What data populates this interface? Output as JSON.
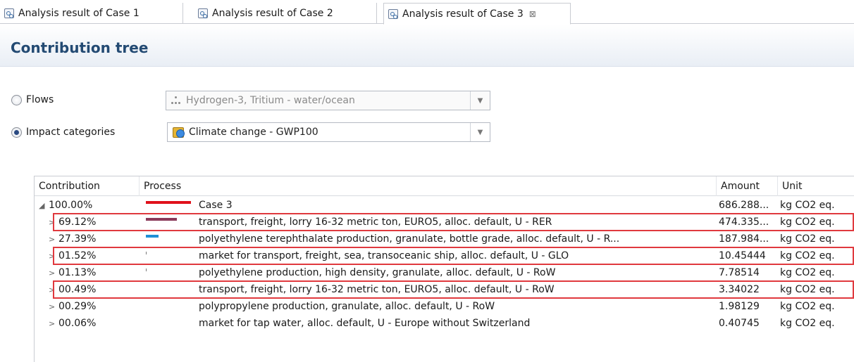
{
  "tabs": [
    {
      "label": "Analysis result of Case 1",
      "active": false
    },
    {
      "label": "Analysis result of Case 2",
      "active": false
    },
    {
      "label": "Analysis result of Case 3",
      "active": true,
      "close": "⊠"
    }
  ],
  "header": {
    "title": "Contribution tree"
  },
  "form": {
    "flows": {
      "label": "Flows",
      "selected": false,
      "value": "Hydrogen-3, Tritium - water/ocean",
      "disabled": true
    },
    "impact": {
      "label": "Impact categories",
      "selected": true,
      "value": "Climate change - GWP100"
    }
  },
  "table": {
    "headers": {
      "contribution": "Contribution",
      "process": "Process",
      "amount": "Amount",
      "unit": "Unit"
    },
    "rows": [
      {
        "toggle": "◢",
        "contribution": "100.00%",
        "process": "Case 3",
        "amount": "686.288...",
        "unit": "kg CO2 eq.",
        "share": 1.0,
        "color": "#e0111b",
        "highlight": false
      },
      {
        "toggle": ">",
        "contribution": "69.12%",
        "process": "transport, freight, lorry 16-32 metric ton, EURO5, alloc. default, U - RER",
        "amount": "474.335...",
        "unit": "kg CO2 eq.",
        "share": 0.6912,
        "color": "#8b3a5a",
        "highlight": true
      },
      {
        "toggle": ">",
        "contribution": "27.39%",
        "process": "polyethylene terephthalate production, granulate, bottle grade, alloc. default, U - R...",
        "amount": "187.984...",
        "unit": "kg CO2 eq.",
        "share": 0.2739,
        "color": "#1f8fd6",
        "highlight": false
      },
      {
        "toggle": ">",
        "contribution": "01.52%",
        "process": "market for transport, freight, sea, transoceanic ship, alloc. default, U - GLO",
        "amount": "10.45444",
        "unit": "kg CO2 eq.",
        "share": 0.0152,
        "color": "#7a7a7a",
        "highlight": true
      },
      {
        "toggle": ">",
        "contribution": "01.13%",
        "process": "polyethylene production, high density, granulate, alloc. default, U - RoW",
        "amount": "7.78514",
        "unit": "kg CO2 eq.",
        "share": 0.0113,
        "color": "#7a7a7a",
        "highlight": false
      },
      {
        "toggle": ">",
        "contribution": "00.49%",
        "process": "transport, freight, lorry 16-32 metric ton, EURO5, alloc. default, U - RoW",
        "amount": "3.34022",
        "unit": "kg CO2 eq.",
        "share": 0.0049,
        "color": "#7a7a7a",
        "highlight": true
      },
      {
        "toggle": ">",
        "contribution": "00.29%",
        "process": "polypropylene production, granulate, alloc. default, U - RoW",
        "amount": "1.98129",
        "unit": "kg CO2 eq.",
        "share": 0.0029,
        "color": "#7a7a7a",
        "highlight": false
      },
      {
        "toggle": ">",
        "contribution": "00.06%",
        "process": "market for tap water, alloc. default, U - Europe without Switzerland",
        "amount": "0.40745",
        "unit": "kg CO2 eq.",
        "share": 0.0006,
        "color": "#7a7a7a",
        "highlight": false
      }
    ]
  }
}
